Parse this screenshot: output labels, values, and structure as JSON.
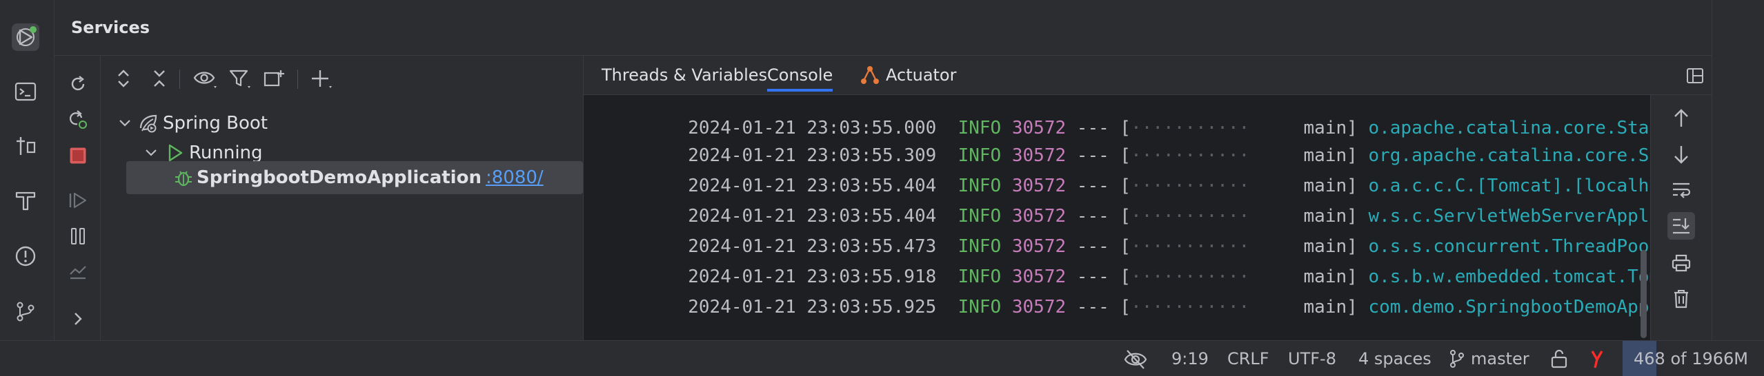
{
  "panel": {
    "title": "Services"
  },
  "left_strip": {
    "icons": [
      "services-icon",
      "terminal-icon",
      "structure-icon",
      "build-icon",
      "problems-icon",
      "git-icon"
    ],
    "services_badge_color": "#5fb760"
  },
  "actions": {
    "icons": [
      "rerun-icon",
      "rerun-debug-icon",
      "stop-icon",
      "resume-icon",
      "pause-icon",
      "coverage-icon",
      "expand-more-icon"
    ],
    "stop_color": "#db5c5c"
  },
  "tree": {
    "toolbar_icons": [
      "expand-all-icon",
      "collapse-all-icon",
      "eye-icon",
      "filter-icon",
      "new-group-icon",
      "add-service-icon"
    ],
    "root": {
      "label": "Spring Boot",
      "icon": "spring-boot-icon"
    },
    "group": {
      "label": "Running",
      "icon": "run-icon"
    },
    "app": {
      "name": "SpringbootDemoApplication",
      "port": ":8080/",
      "icon": "debug-bug-icon"
    }
  },
  "tabs": [
    {
      "label": "Threads & Variables",
      "active": false
    },
    {
      "label": "Console",
      "active": true
    },
    {
      "label": "Actuator",
      "active": false,
      "icon": "actuator-icon"
    }
  ],
  "console": {
    "partial_line": {
      "timestamp": "2024-01-21 23:03:55.000",
      "level": "INFO",
      "pid": "30572",
      "sep": "--- [",
      "thread": "main]",
      "logger": "o.apache.catalina.core.StandardService"
    },
    "lines": [
      {
        "timestamp": "2024-01-21 23:03:55.309",
        "level": "INFO",
        "pid": "30572",
        "sep": "--- [",
        "thread": "main]",
        "logger": "org.apache.catalina.core.StandardEngine"
      },
      {
        "timestamp": "2024-01-21 23:03:55.404",
        "level": "INFO",
        "pid": "30572",
        "sep": "--- [",
        "thread": "main]",
        "logger": "o.a.c.c.C.[Tomcat].[localhost].[/]"
      },
      {
        "timestamp": "2024-01-21 23:03:55.404",
        "level": "INFO",
        "pid": "30572",
        "sep": "--- [",
        "thread": "main]",
        "logger": "w.s.c.ServletWebServerApplicationContext"
      },
      {
        "timestamp": "2024-01-21 23:03:55.473",
        "level": "INFO",
        "pid": "30572",
        "sep": "--- [",
        "thread": "main]",
        "logger": "o.s.s.concurrent.ThreadPoolTaskExecutor"
      },
      {
        "timestamp": "2024-01-21 23:03:55.918",
        "level": "INFO",
        "pid": "30572",
        "sep": "--- [",
        "thread": "main]",
        "logger": "o.s.b.w.embedded.tomcat.TomcatWebServer"
      },
      {
        "timestamp": "2024-01-21 23:03:55.925",
        "level": "INFO",
        "pid": "30572",
        "sep": "--- [",
        "thread": "main]",
        "logger": "com.demo.SpringbootDemoApplication"
      }
    ],
    "rail_icons": [
      "scroll-up-icon",
      "scroll-down-icon",
      "soft-wrap-icon",
      "scroll-to-end-icon",
      "print-icon",
      "clear-icon"
    ]
  },
  "status_bar": {
    "line_col": "9:19",
    "line_separator": "CRLF",
    "encoding": "UTF-8",
    "indent": "4 spaces",
    "branch": "master",
    "memory": "468 of 1966M",
    "memory_used_fraction": 0.238,
    "yandex_color": "#ff2a2a"
  }
}
